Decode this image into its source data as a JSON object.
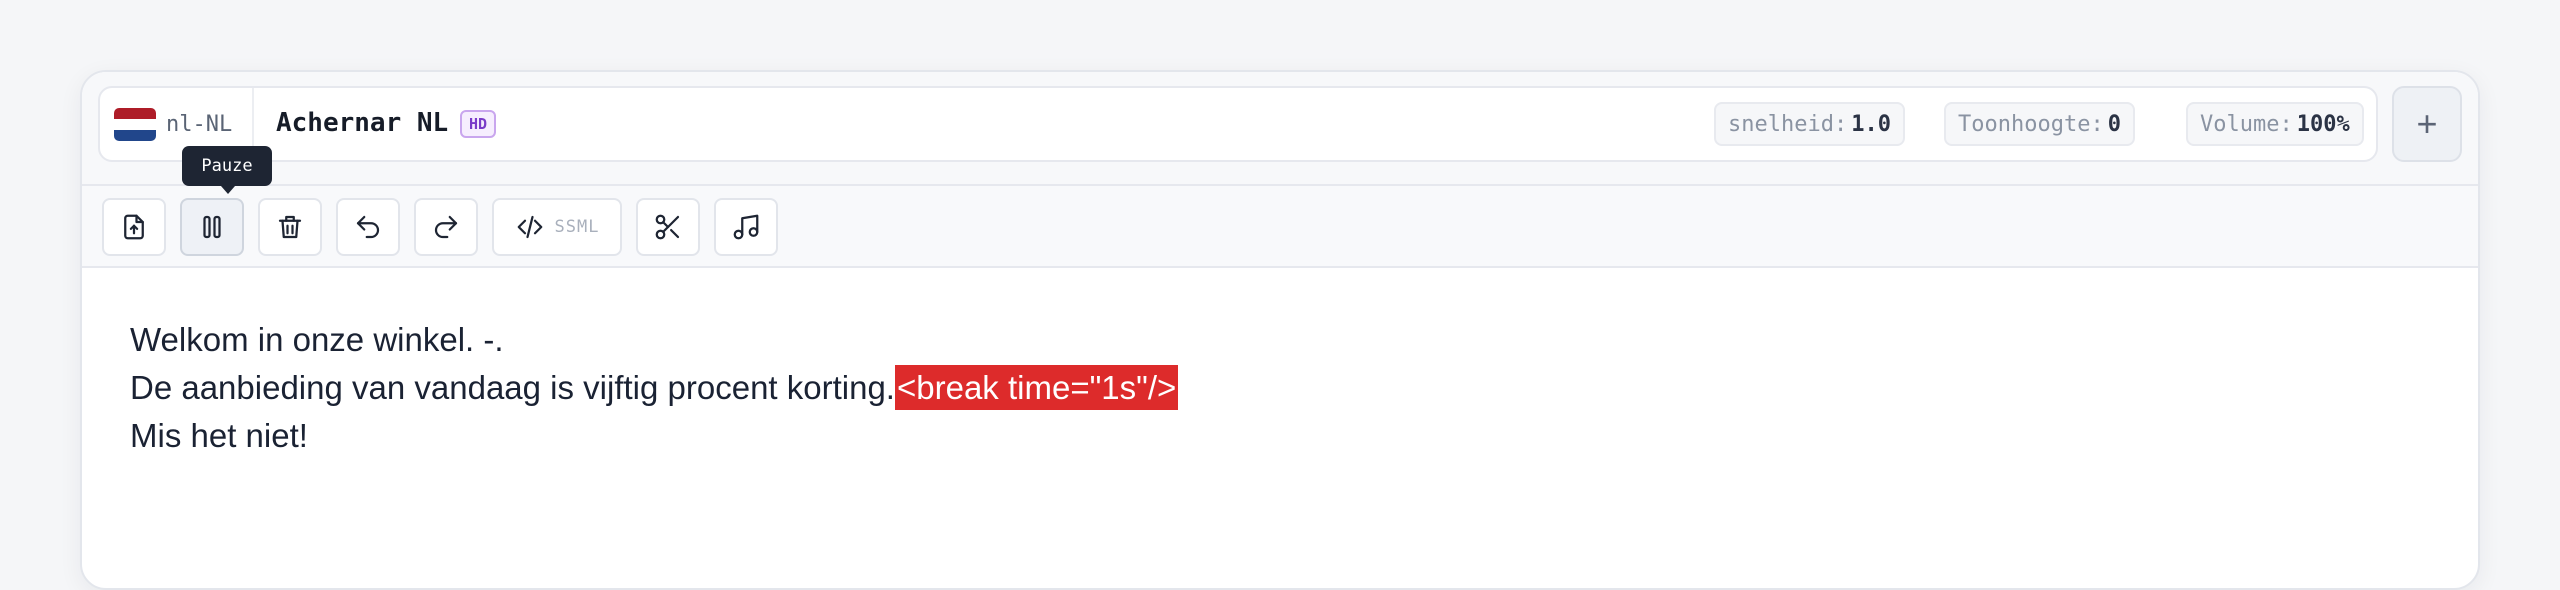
{
  "header": {
    "locale": "nl-NL",
    "voice_name": "Achernar NL",
    "badge": "HD",
    "params": [
      {
        "label": "snelheid:",
        "value": "1.0"
      },
      {
        "label": "Toonhoogte:",
        "value": "0"
      },
      {
        "label": "Volume:",
        "value": "100%"
      }
    ],
    "add_label": "+"
  },
  "toolbar": {
    "ssml_label": "SSML",
    "tooltip": "Pauze",
    "buttons": [
      "upload-icon",
      "pause-icon",
      "trash-icon",
      "undo-icon",
      "redo-icon",
      "code-icon",
      "scissors-icon",
      "music-icon"
    ]
  },
  "editor": {
    "line1": "Welkom in onze winkel. -.",
    "line2_text": "De aanbieding van vandaag is vijftig procent korting.",
    "line2_tag": "<break time=\"1s\"/>",
    "line3": "Mis het niet!"
  },
  "colors": {
    "tag_highlight": "#dd2b2b",
    "flag_red": "#ae1c28",
    "flag_white": "#ffffff",
    "flag_blue": "#21468b",
    "hd_badge": "#7a3cc8"
  }
}
